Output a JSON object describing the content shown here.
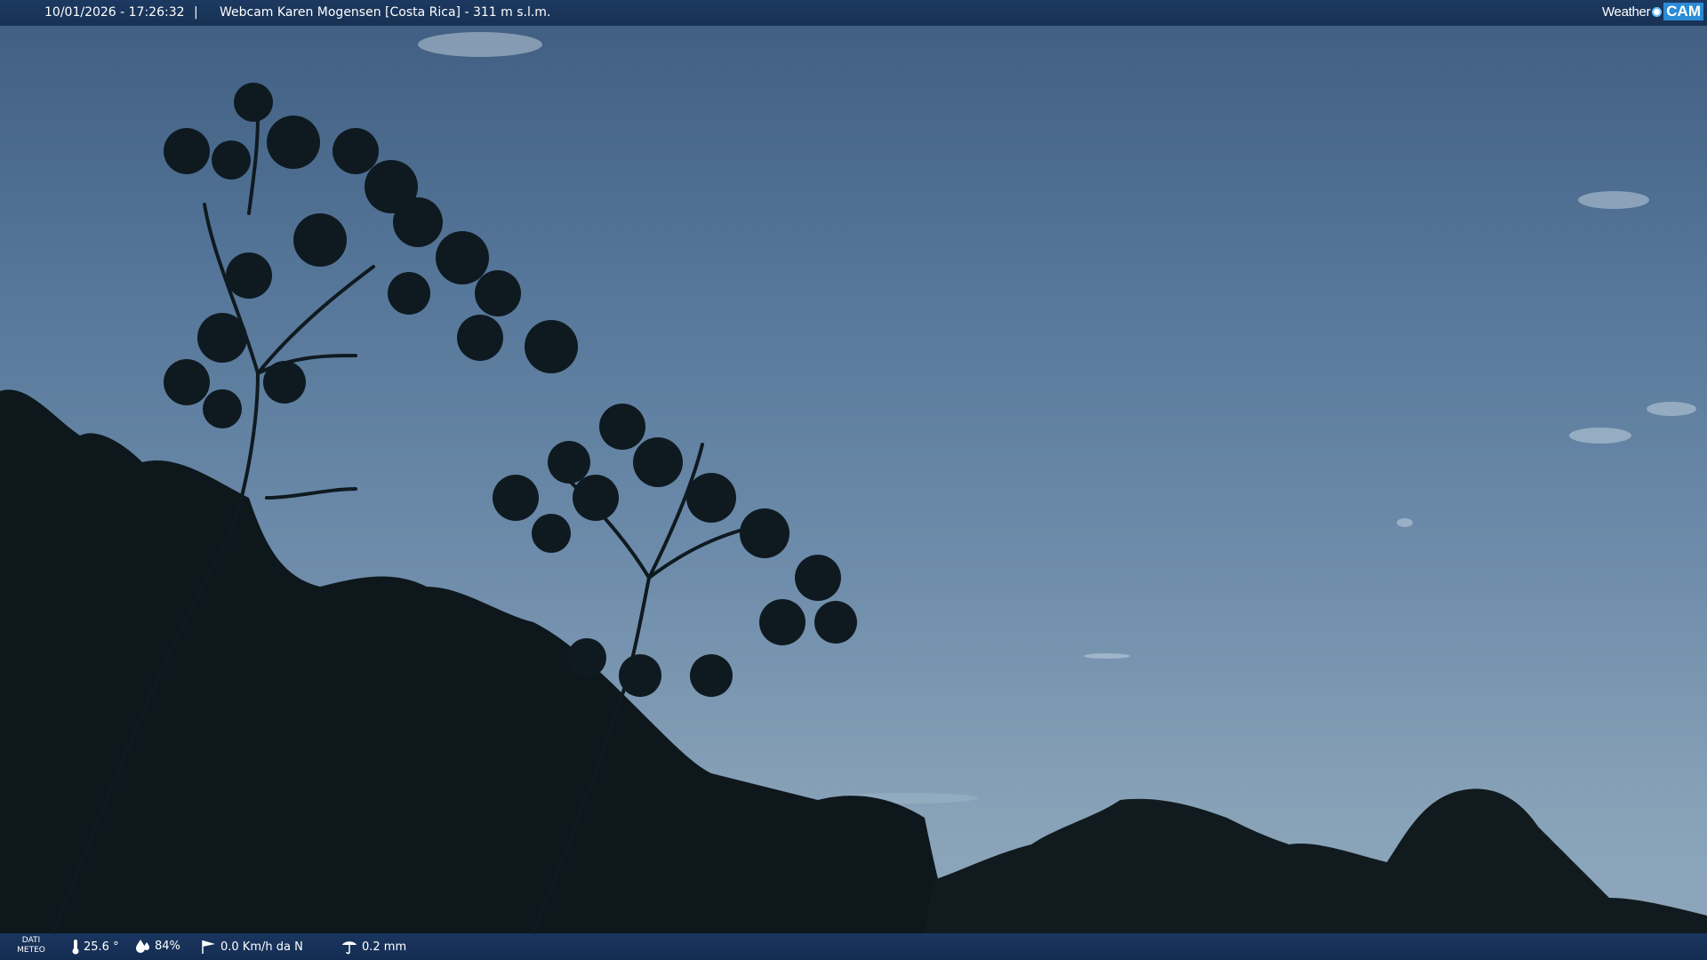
{
  "header": {
    "datetime": "10/01/2026 - 17:26:32",
    "separator": "|",
    "title": "Webcam Karen Mogensen [Costa Rica]  - 311 m s.l.m.",
    "logo": {
      "weather_text": "Weather",
      "cam_text": "CAM"
    }
  },
  "footer": {
    "dati_line1": "DATI",
    "dati_line2": "METEO",
    "temperature": "25.6 °",
    "humidity": "84%",
    "wind": "0.0 Km/h da N",
    "rain": "0.2 mm",
    "icons": [
      "thermometer-icon",
      "humidity-icon",
      "wind-icon",
      "rain-gauge-icon"
    ]
  },
  "colors": {
    "bar_background": "#1a375f",
    "logo_accent": "#2c8bd6",
    "text": "#ffffff"
  }
}
